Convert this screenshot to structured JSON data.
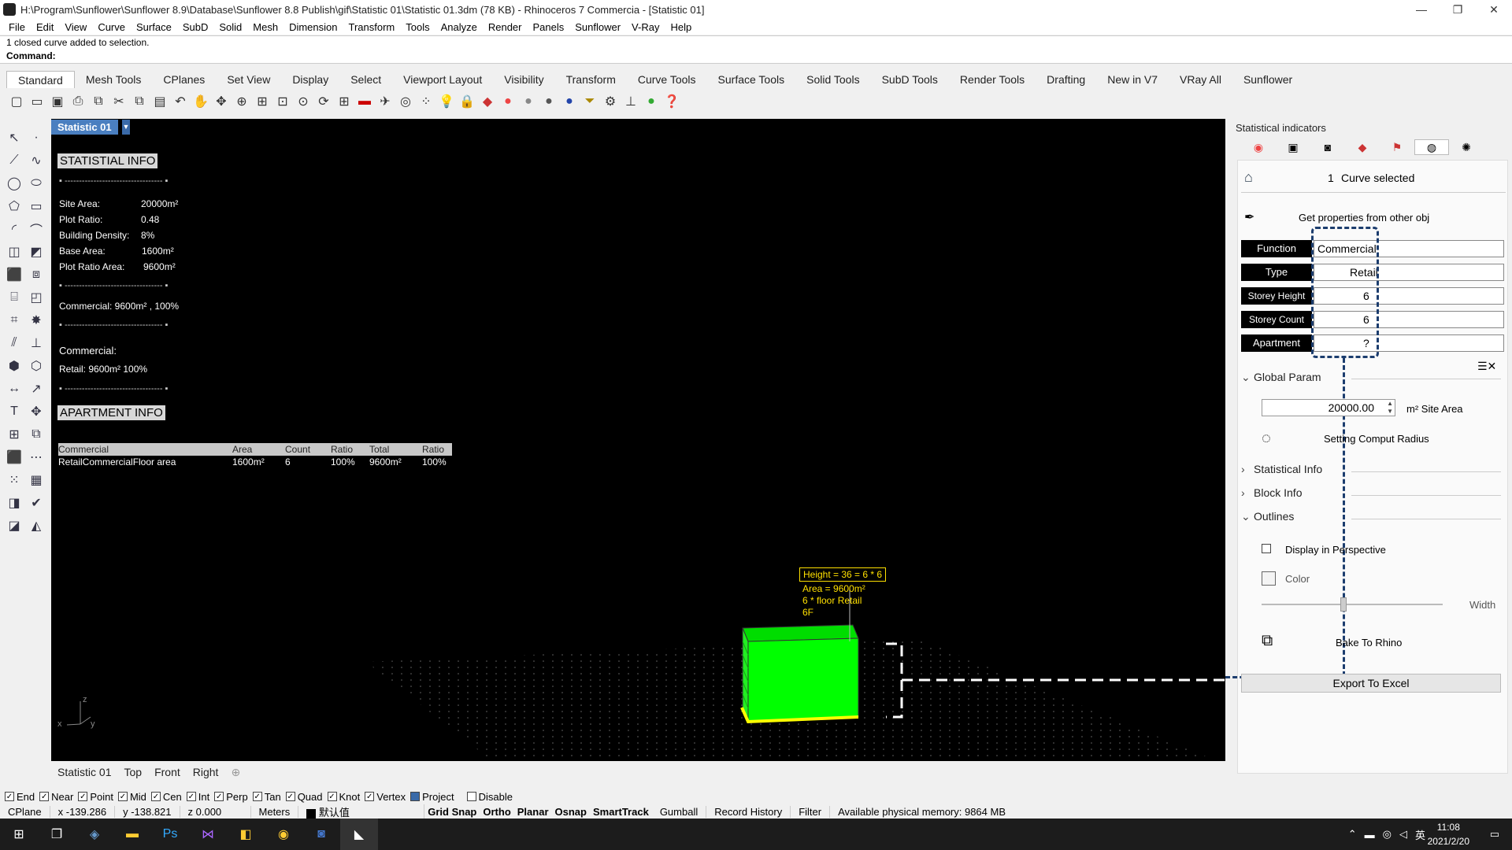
{
  "window": {
    "title": "H:\\Program\\Sunflower\\Sunflower 8.9\\Database\\Sunflower 8.8 Publish\\gif\\Statistic 01\\Statistic 01.3dm (78 KB) - Rhinoceros 7 Commercia - [Statistic 01]",
    "min": "—",
    "max": "❐",
    "close": "✕"
  },
  "menu": [
    "File",
    "Edit",
    "View",
    "Curve",
    "Surface",
    "SubD",
    "Solid",
    "Mesh",
    "Dimension",
    "Transform",
    "Tools",
    "Analyze",
    "Render",
    "Panels",
    "Sunflower",
    "V-Ray",
    "Help"
  ],
  "command": {
    "history": "1 closed curve added to selection.",
    "prompt": "Command:"
  },
  "tabs": [
    "Standard",
    "Mesh Tools",
    "CPlanes",
    "Set View",
    "Display",
    "Select",
    "Viewport Layout",
    "Visibility",
    "Transform",
    "Curve Tools",
    "Surface Tools",
    "Solid Tools",
    "SubD Tools",
    "Render Tools",
    "Drafting",
    "New in V7",
    "VRay All",
    "Sunflower"
  ],
  "viewport": {
    "name": "Statistic 01",
    "statistical_heading": "STATISTIAL INFO",
    "dash": "▪ ---------------------------------- ▪",
    "site_area_label": "Site Area:",
    "site_area": "20000m²",
    "plot_ratio_label": "Plot Ratio:",
    "plot_ratio": "0.48",
    "density_label": "Building Density:",
    "density": "8%",
    "base_area_label": "Base Area:",
    "base_area": "1600m²",
    "plot_ratio_area_label": "Plot Ratio Area:",
    "plot_ratio_area": "9600m²",
    "commercial_summary": "Commercial:   9600m² , 100%",
    "commercial_label": "Commercial:",
    "retail_summary": "Retail:   9600m²  100%",
    "apartment_heading": "APARTMENT INFO",
    "table_headers": [
      "Commercial",
      "Area",
      "Count",
      "Ratio",
      "Total",
      "Ratio"
    ],
    "table_row": [
      "RetailCommercialFloor area",
      "1600m²",
      "6",
      "100%",
      "9600m²",
      "100%"
    ],
    "bldg_height": "Height = 36 = 6 * 6",
    "bldg_area": "Area = 9600m²",
    "bldg_floor": "6 * floor Retail",
    "bldg_storeys": "6F",
    "axis_z": "z",
    "axis_x": "x",
    "axis_y": "y"
  },
  "view_tabs": [
    "Statistic 01",
    "Top",
    "Front",
    "Right",
    "⊕"
  ],
  "osnaps": [
    {
      "label": "End",
      "on": true
    },
    {
      "label": "Near",
      "on": true
    },
    {
      "label": "Point",
      "on": true
    },
    {
      "label": "Mid",
      "on": true
    },
    {
      "label": "Cen",
      "on": true
    },
    {
      "label": "Int",
      "on": true
    },
    {
      "label": "Perp",
      "on": true
    },
    {
      "label": "Tan",
      "on": true
    },
    {
      "label": "Quad",
      "on": true
    },
    {
      "label": "Knot",
      "on": true
    },
    {
      "label": "Vertex",
      "on": true
    },
    {
      "label": "Project",
      "on": false
    },
    {
      "label": "Disable",
      "on": false
    }
  ],
  "status": {
    "cplane": "CPlane",
    "x": "x -139.286",
    "y": "y -138.821",
    "z": "z 0.000",
    "units": "Meters",
    "layer": "默认值",
    "grid_snap": "Grid Snap",
    "ortho": "Ortho",
    "planar": "Planar",
    "osnap": "Osnap",
    "smarttrack": "SmartTrack",
    "gumball": "Gumball",
    "record": "Record History",
    "filter": "Filter",
    "memory": "Available physical memory: 9864 MB"
  },
  "panel": {
    "title": "Statistical indicators",
    "selected_count": "1",
    "selected_text": "Curve selected",
    "get_props": "Get properties from other obj",
    "fields": [
      {
        "label": "Function",
        "value": "Commercial",
        "align": "left"
      },
      {
        "label": "Type",
        "value": "Retail",
        "align": "right"
      },
      {
        "label": "Storey Height",
        "value": "6",
        "align": "right"
      },
      {
        "label": "Storey Count",
        "value": "6",
        "align": "right"
      },
      {
        "label": "Apartment",
        "value": "?",
        "align": "right"
      }
    ],
    "global_param": "Global Param",
    "site_area_value": "20000.00",
    "site_area_unit": "m² Site Area",
    "setting_radius": "Setting Comput Radius",
    "statistical_info": "Statistical Info",
    "block_info": "Block Info",
    "outlines": "Outlines",
    "display_persp": "Display in Perspective",
    "color": "Color",
    "width": "Width",
    "bake": "Bake To Rhino",
    "export": "Export To Excel"
  },
  "taskbar": {
    "time": "11:08",
    "date": "2021/2/20",
    "ime": "英"
  }
}
